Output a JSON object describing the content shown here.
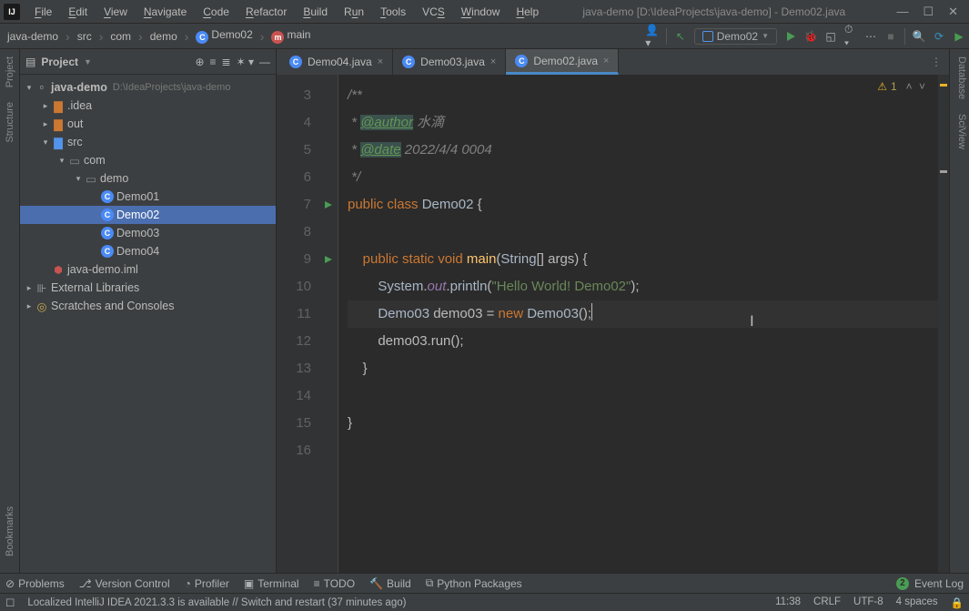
{
  "titlebar": {
    "menu": [
      "File",
      "Edit",
      "View",
      "Navigate",
      "Code",
      "Refactor",
      "Build",
      "Run",
      "Tools",
      "VCS",
      "Window",
      "Help"
    ],
    "title": "java-demo [D:\\IdeaProjects\\java-demo] - Demo02.java"
  },
  "breadcrumb": {
    "items": [
      "java-demo",
      "src",
      "com",
      "demo",
      "Demo02",
      "main"
    ]
  },
  "run_config": {
    "label": "Demo02"
  },
  "tool_windows": {
    "left": [
      "Project",
      "Structure",
      "Bookmarks"
    ],
    "right": [
      "Database",
      "SciView"
    ]
  },
  "project_panel": {
    "title": "Project",
    "root": {
      "name": "java-demo",
      "path": "D:\\IdeaProjects\\java-demo"
    },
    "items": [
      {
        "kind": "folder-idea",
        "name": ".idea",
        "depth": 1,
        "expanded": false
      },
      {
        "kind": "folder-out",
        "name": "out",
        "depth": 1,
        "expanded": false
      },
      {
        "kind": "folder-src",
        "name": "src",
        "depth": 1,
        "expanded": true
      },
      {
        "kind": "folder-pkg",
        "name": "com",
        "depth": 2,
        "expanded": true
      },
      {
        "kind": "folder-pkg",
        "name": "demo",
        "depth": 3,
        "expanded": true
      },
      {
        "kind": "class",
        "name": "Demo01",
        "depth": 4
      },
      {
        "kind": "class",
        "name": "Demo02",
        "depth": 4,
        "selected": true
      },
      {
        "kind": "class",
        "name": "Demo03",
        "depth": 4
      },
      {
        "kind": "class",
        "name": "Demo04",
        "depth": 4
      },
      {
        "kind": "iml",
        "name": "java-demo.iml",
        "depth": 1
      }
    ],
    "extras": [
      "External Libraries",
      "Scratches and Consoles"
    ]
  },
  "editor_tabs": [
    {
      "label": "Demo04.java",
      "active": false
    },
    {
      "label": "Demo03.java",
      "active": false
    },
    {
      "label": "Demo02.java",
      "active": true
    }
  ],
  "warnings": {
    "count": "1"
  },
  "code": {
    "lines": [
      {
        "n": 3,
        "t": "doc",
        "text": "/**"
      },
      {
        "n": 4,
        "t": "doc-author",
        "tag": "@author",
        "rest": " 水滴"
      },
      {
        "n": 5,
        "t": "doc-date",
        "tag": "@date",
        "rest": " 2022/4/4 0004"
      },
      {
        "n": 6,
        "t": "doc",
        "text": " */"
      },
      {
        "n": 7,
        "t": "class-decl",
        "text": "public class Demo02 {"
      },
      {
        "n": 8,
        "t": "blank",
        "text": ""
      },
      {
        "n": 9,
        "t": "main-decl",
        "text": "    public static void main(String[] args) {"
      },
      {
        "n": 10,
        "t": "println",
        "text": "        System.out.println(\"Hello World! Demo02\");"
      },
      {
        "n": 11,
        "t": "new",
        "text": "        Demo03 demo03 = new Demo03();"
      },
      {
        "n": 12,
        "t": "call",
        "text": "        demo03.run();"
      },
      {
        "n": 13,
        "t": "plain",
        "text": "    }"
      },
      {
        "n": 14,
        "t": "blank",
        "text": ""
      },
      {
        "n": 15,
        "t": "plain",
        "text": "}"
      },
      {
        "n": 16,
        "t": "blank",
        "text": ""
      }
    ]
  },
  "bottom_tabs": [
    "Problems",
    "Version Control",
    "Profiler",
    "Terminal",
    "TODO",
    "Build",
    "Python Packages"
  ],
  "event_log": "Event Log",
  "status": {
    "message": "Localized IntelliJ IDEA 2021.3.3 is available // Switch and restart (37 minutes ago)",
    "time": "11:38",
    "eol": "CRLF",
    "encoding": "UTF-8",
    "indent": "4 spaces"
  }
}
